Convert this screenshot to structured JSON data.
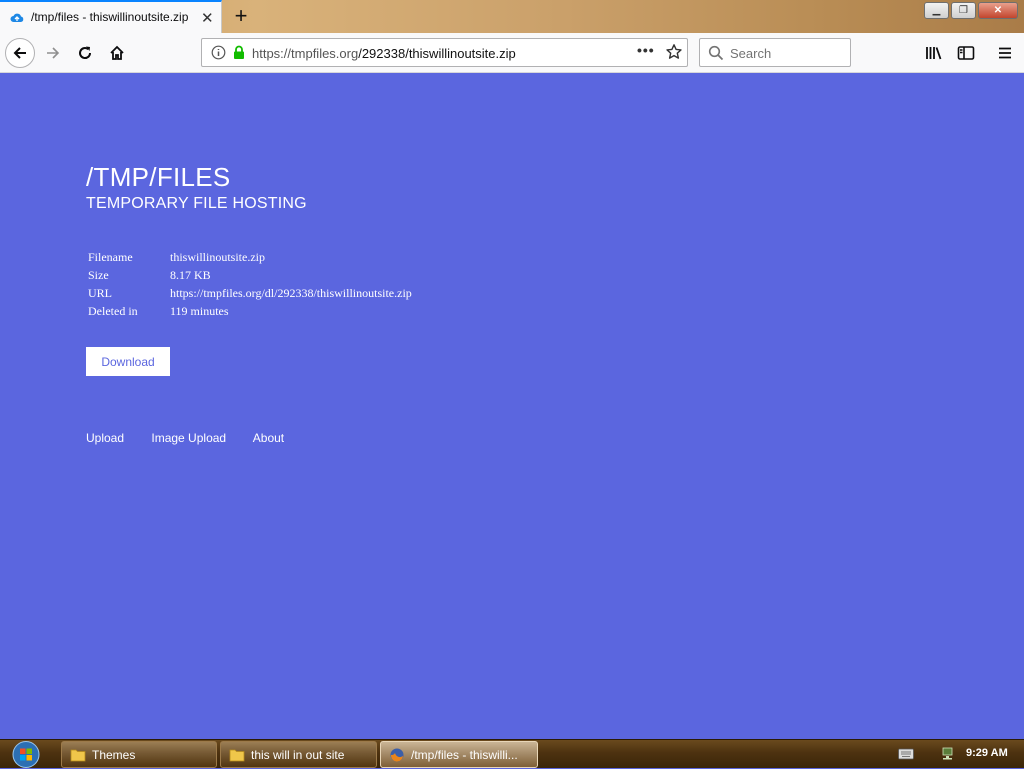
{
  "browser": {
    "tab_title": "/tmp/files - thiswillinoutsite.zip",
    "url_host": "https://tmpfiles.org",
    "url_path": "/292338/thiswillinoutsite.zip",
    "search_placeholder": "Search",
    "icons": [
      "cloud-upload-icon",
      "close-icon",
      "plus-icon",
      "back-arrow-icon",
      "forward-arrow-icon",
      "reload-icon",
      "home-icon",
      "info-icon",
      "lock-icon",
      "more-icon",
      "star-icon",
      "search-icon",
      "library-icon",
      "sidebar-icon",
      "menu-icon"
    ]
  },
  "page": {
    "title": "/TMP/FILES",
    "subtitle": "TEMPORARY FILE HOSTING",
    "file_info": [
      {
        "key": "Filename",
        "value": "thiswillinoutsite.zip"
      },
      {
        "key": "Size",
        "value": "8.17 KB"
      },
      {
        "key": "URL",
        "value": "https://tmpfiles.org/dl/292338/thiswillinoutsite.zip"
      },
      {
        "key": "Deleted in",
        "value": "119 minutes"
      }
    ],
    "download_label": "Download",
    "footer_links": [
      "Upload",
      "Image Upload",
      "About"
    ],
    "colors": {
      "background": "#5b66df",
      "text": "#ffffff"
    }
  },
  "taskbar": {
    "items": [
      {
        "label": "Themes",
        "icon": "folder-icon"
      },
      {
        "label": "this will in out site",
        "icon": "folder-icon"
      },
      {
        "label": "/tmp/files - thiswilli...",
        "icon": "firefox-icon"
      }
    ],
    "clock": "9:29 AM"
  }
}
